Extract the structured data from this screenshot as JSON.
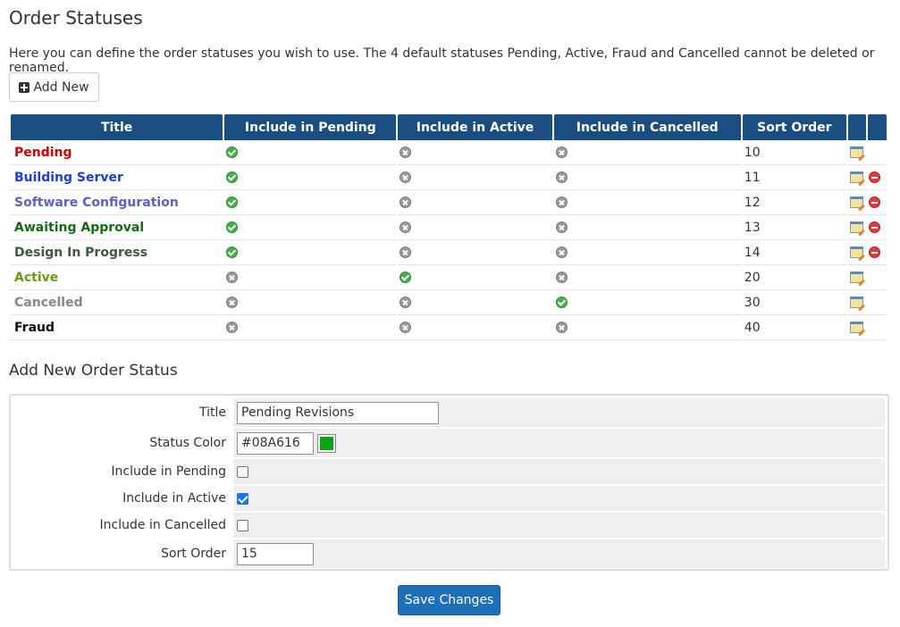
{
  "page": {
    "title": "Order Statuses",
    "description": "Here you can define the order statuses you wish to use. The 4 default statuses Pending, Active, Fraud and Cancelled cannot be deleted or renamed.",
    "add_new_label": "Add New"
  },
  "table": {
    "headers": [
      "Title",
      "Include in Pending",
      "Include in Active",
      "Include in Cancelled",
      "Sort Order",
      "",
      ""
    ],
    "rows": [
      {
        "title": "Pending",
        "color": "#cc0000",
        "pending": true,
        "active": false,
        "cancelled": false,
        "sort": "10",
        "deletable": false
      },
      {
        "title": "Building Server",
        "color": "#1f3fcf",
        "pending": true,
        "active": false,
        "cancelled": false,
        "sort": "11",
        "deletable": true
      },
      {
        "title": "Software Configuration",
        "color": "#5b5fc7",
        "pending": true,
        "active": false,
        "cancelled": false,
        "sort": "12",
        "deletable": true
      },
      {
        "title": "Awaiting Approval",
        "color": "#146b14",
        "pending": true,
        "active": false,
        "cancelled": false,
        "sort": "13",
        "deletable": true
      },
      {
        "title": "Design In Progress",
        "color": "#3d5a3d",
        "pending": true,
        "active": false,
        "cancelled": false,
        "sort": "14",
        "deletable": true
      },
      {
        "title": "Active",
        "color": "#6b9a13",
        "pending": false,
        "active": true,
        "cancelled": false,
        "sort": "20",
        "deletable": false
      },
      {
        "title": "Cancelled",
        "color": "#888888",
        "pending": false,
        "active": false,
        "cancelled": true,
        "sort": "30",
        "deletable": false
      },
      {
        "title": "Fraud",
        "color": "#111111",
        "pending": false,
        "active": false,
        "cancelled": false,
        "sort": "40",
        "deletable": false
      }
    ]
  },
  "form": {
    "heading": "Add New Order Status",
    "title_label": "Title",
    "title_value": "Pending Revisions",
    "color_label": "Status Color",
    "color_value": "#08A616",
    "pending_label": "Include in Pending",
    "pending_checked": false,
    "active_label": "Include in Active",
    "active_checked": true,
    "cancelled_label": "Include in Cancelled",
    "cancelled_checked": false,
    "sort_label": "Sort Order",
    "sort_value": "15"
  },
  "save_label": "Save Changes"
}
